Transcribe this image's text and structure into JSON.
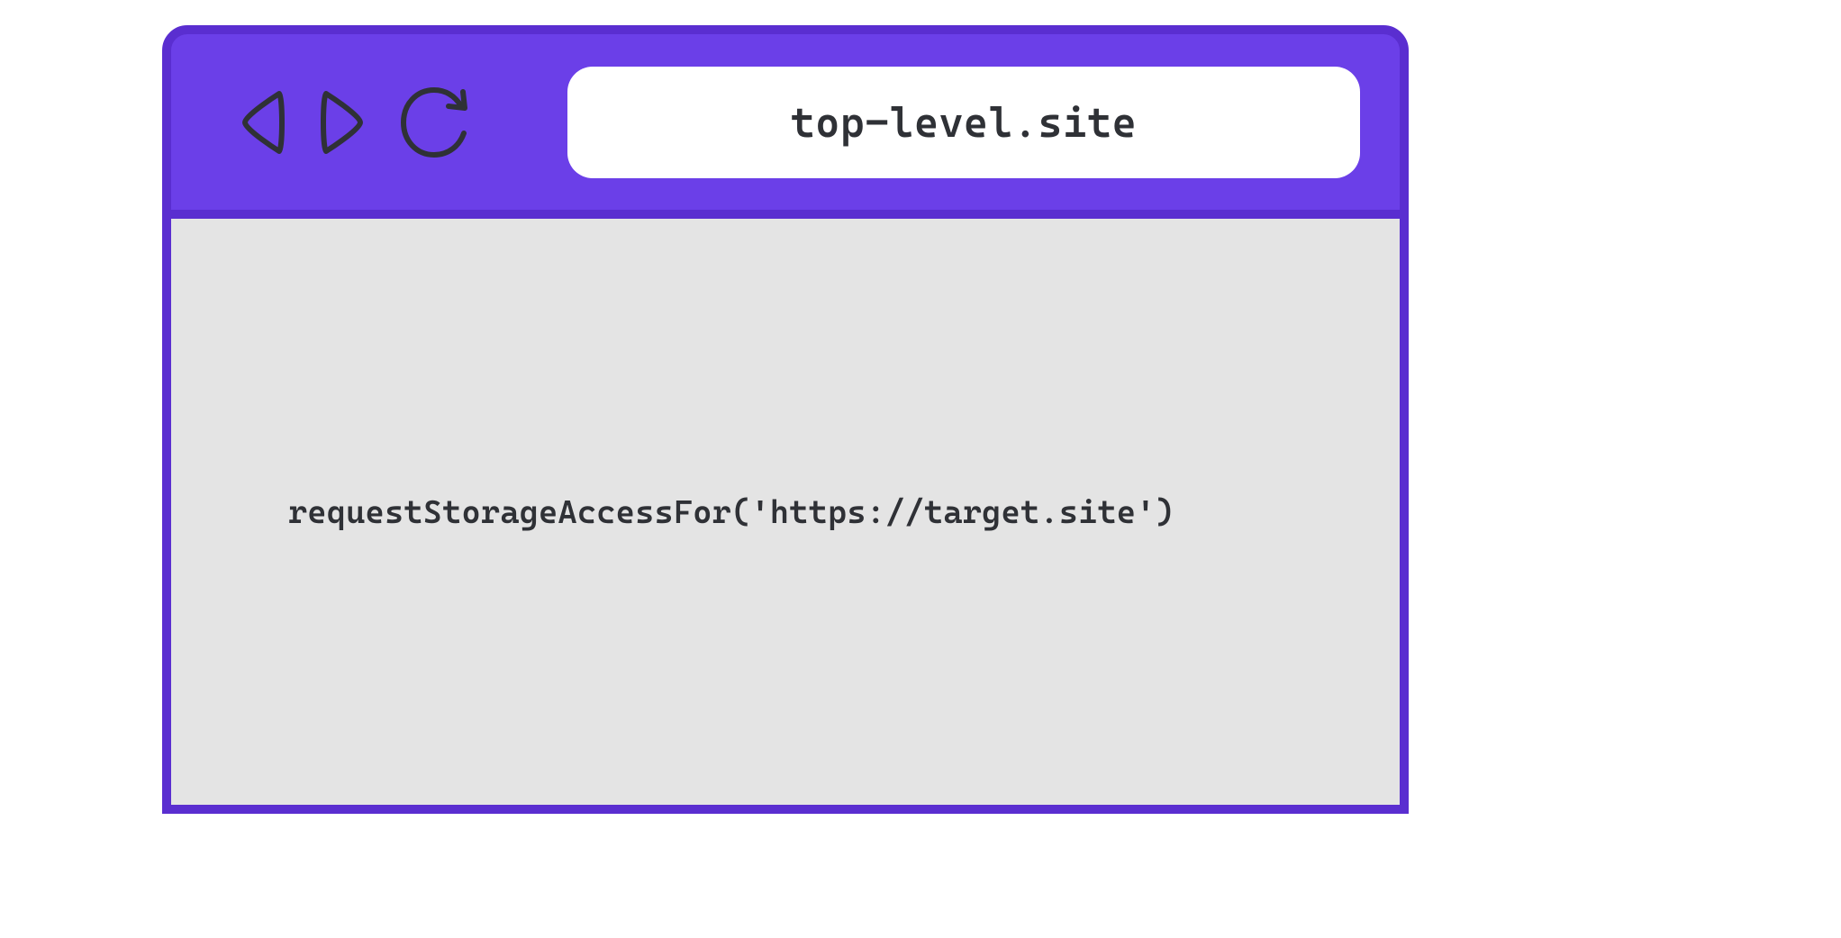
{
  "browser": {
    "address": "top-level.site"
  },
  "page": {
    "code": "requestStorageAccessFor('https://target.site')"
  },
  "colors": {
    "chrome_bg": "#6b3fe8",
    "chrome_border": "#5a2ed0",
    "viewport_bg": "#e4e4e4",
    "text": "#2f3136"
  }
}
